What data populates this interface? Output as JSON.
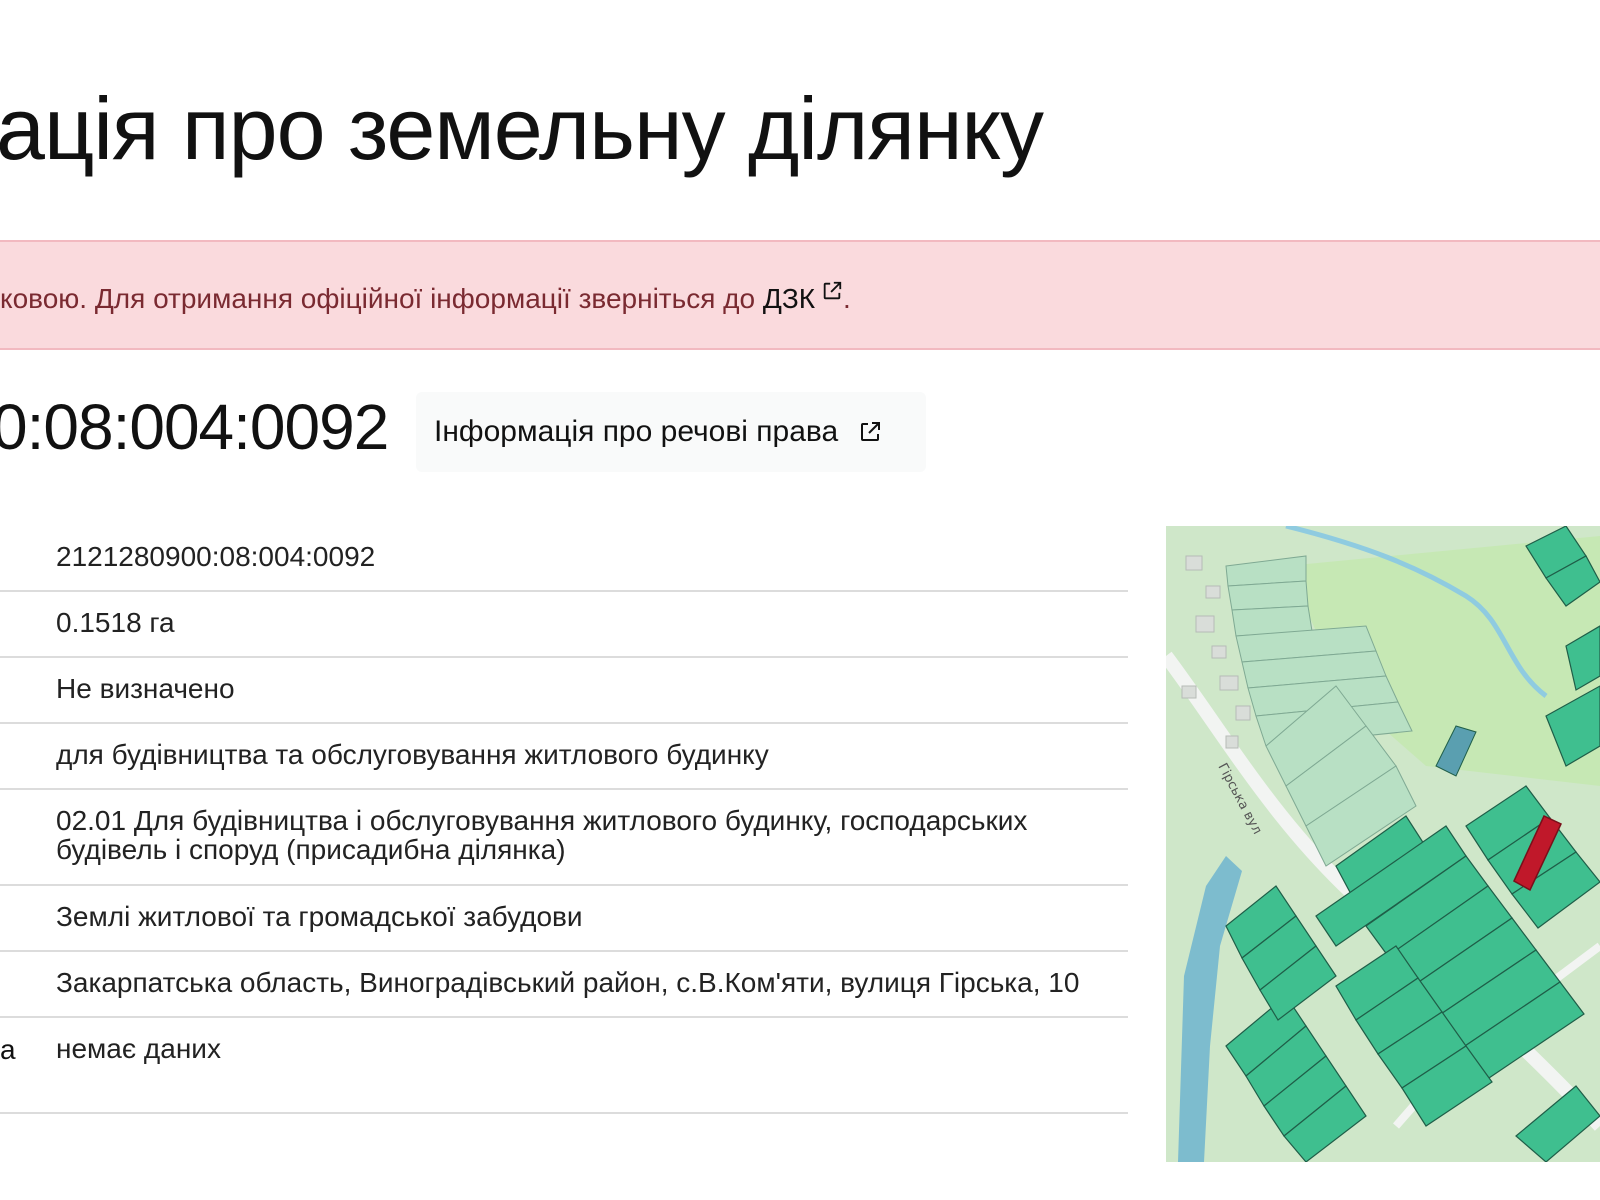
{
  "header": {
    "title": "ація про земельну ділянку"
  },
  "alert": {
    "text": "ковою. Для отримання офіційної інформації зверніться до ",
    "link_label": "ДЗК",
    "suffix": "."
  },
  "parcel": {
    "cadastral_number_partial": "0:08:004:0092",
    "rights_button_label": "Інформація про речові права"
  },
  "info_rows": [
    {
      "label": "",
      "value": "2121280900:08:004:0092"
    },
    {
      "label": "",
      "value": "0.1518 га"
    },
    {
      "label": "",
      "value": "Не визначено"
    },
    {
      "label": "",
      "value": "для будівництва та обслуговування житлового будинку"
    },
    {
      "label": "",
      "value": "02.01 Для будівництва і обслуговування житлового будинку, господарських будівель і споруд (присадибна ділянка)"
    },
    {
      "label": "",
      "value": "Землі житлової та громадської забудови"
    },
    {
      "label": "",
      "value": "Закарпатська область, Виноградівський район, с.В.Ком'яти, вулиця Гірська, 10"
    },
    {
      "label": "а",
      "value": "немає даних"
    }
  ],
  "map": {
    "street_label": "Гірська вул",
    "colors": {
      "parcel": "#3fbf8f",
      "parcel_edge": "#1f5e48",
      "highlight": "#c0182a",
      "water": "#6fb4cf",
      "background": "#cfe7c9"
    }
  }
}
